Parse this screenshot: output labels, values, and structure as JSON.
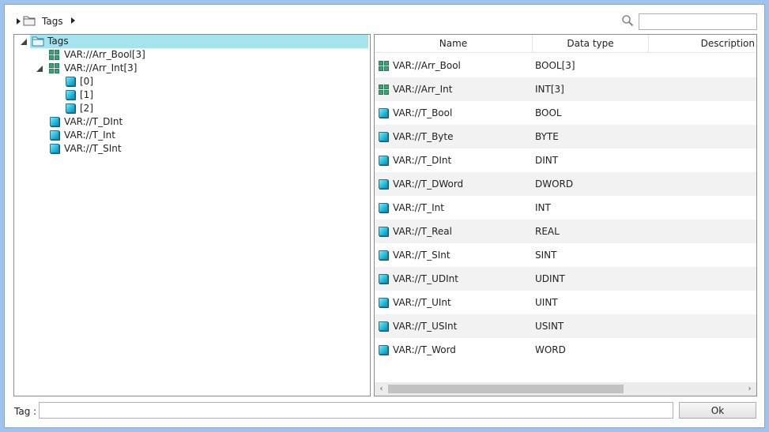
{
  "breadcrumb": {
    "label": "Tags",
    "icons": [
      "expand-triangle-icon",
      "folder-icon",
      "next-triangle-icon"
    ]
  },
  "search": {
    "placeholder": "",
    "value": "",
    "icon": "search-icon"
  },
  "tree": {
    "root": {
      "label": "Tags",
      "icon": "folder-icon",
      "expanded": true,
      "selected": true
    },
    "items": [
      {
        "label": "VAR://Arr_Bool[3]",
        "icon": "array-grid-icon",
        "expander": "none"
      },
      {
        "label": "VAR://Arr_Int[3]",
        "icon": "array-grid-icon",
        "expander": "expanded"
      },
      {
        "label": "[0]",
        "icon": "tag-cube-icon",
        "expander": "none"
      },
      {
        "label": "[1]",
        "icon": "tag-cube-icon",
        "expander": "none"
      },
      {
        "label": "[2]",
        "icon": "tag-cube-icon",
        "expander": "none"
      },
      {
        "label": "VAR://T_DInt",
        "icon": "tag-cube-icon",
        "expander": "none"
      },
      {
        "label": "VAR://T_Int",
        "icon": "tag-cube-icon",
        "expander": "none"
      },
      {
        "label": "VAR://T_SInt",
        "icon": "tag-cube-icon",
        "expander": "none"
      }
    ]
  },
  "table": {
    "columns": [
      "Name",
      "Data type",
      "Description"
    ],
    "rows": [
      {
        "name": "VAR://Arr_Bool",
        "type": "BOOL[3]",
        "description": "",
        "icon": "array-grid-icon"
      },
      {
        "name": "VAR://Arr_Int",
        "type": "INT[3]",
        "description": "",
        "icon": "array-grid-icon"
      },
      {
        "name": "VAR://T_Bool",
        "type": "BOOL",
        "description": "",
        "icon": "tag-cube-icon"
      },
      {
        "name": "VAR://T_Byte",
        "type": "BYTE",
        "description": "",
        "icon": "tag-cube-icon"
      },
      {
        "name": "VAR://T_DInt",
        "type": "DINT",
        "description": "",
        "icon": "tag-cube-icon"
      },
      {
        "name": "VAR://T_DWord",
        "type": "DWORD",
        "description": "",
        "icon": "tag-cube-icon"
      },
      {
        "name": "VAR://T_Int",
        "type": "INT",
        "description": "",
        "icon": "tag-cube-icon"
      },
      {
        "name": "VAR://T_Real",
        "type": "REAL",
        "description": "",
        "icon": "tag-cube-icon"
      },
      {
        "name": "VAR://T_SInt",
        "type": "SINT",
        "description": "",
        "icon": "tag-cube-icon"
      },
      {
        "name": "VAR://T_UDInt",
        "type": "UDINT",
        "description": "",
        "icon": "tag-cube-icon"
      },
      {
        "name": "VAR://T_UInt",
        "type": "UINT",
        "description": "",
        "icon": "tag-cube-icon"
      },
      {
        "name": "VAR://T_USInt",
        "type": "USINT",
        "description": "",
        "icon": "tag-cube-icon"
      },
      {
        "name": "VAR://T_Word",
        "type": "WORD",
        "description": "",
        "icon": "tag-cube-icon"
      }
    ],
    "scroll": {
      "left_arrow": "‹",
      "right_arrow": "›"
    }
  },
  "footer": {
    "tag_label": "Tag :",
    "tag_value": "",
    "ok_label": "Ok"
  },
  "colors": {
    "selection": "#a5e4ef",
    "frame": "#9ec3ee",
    "array_icon": "#3aa37a",
    "tag_icon": "#23b7d9"
  }
}
